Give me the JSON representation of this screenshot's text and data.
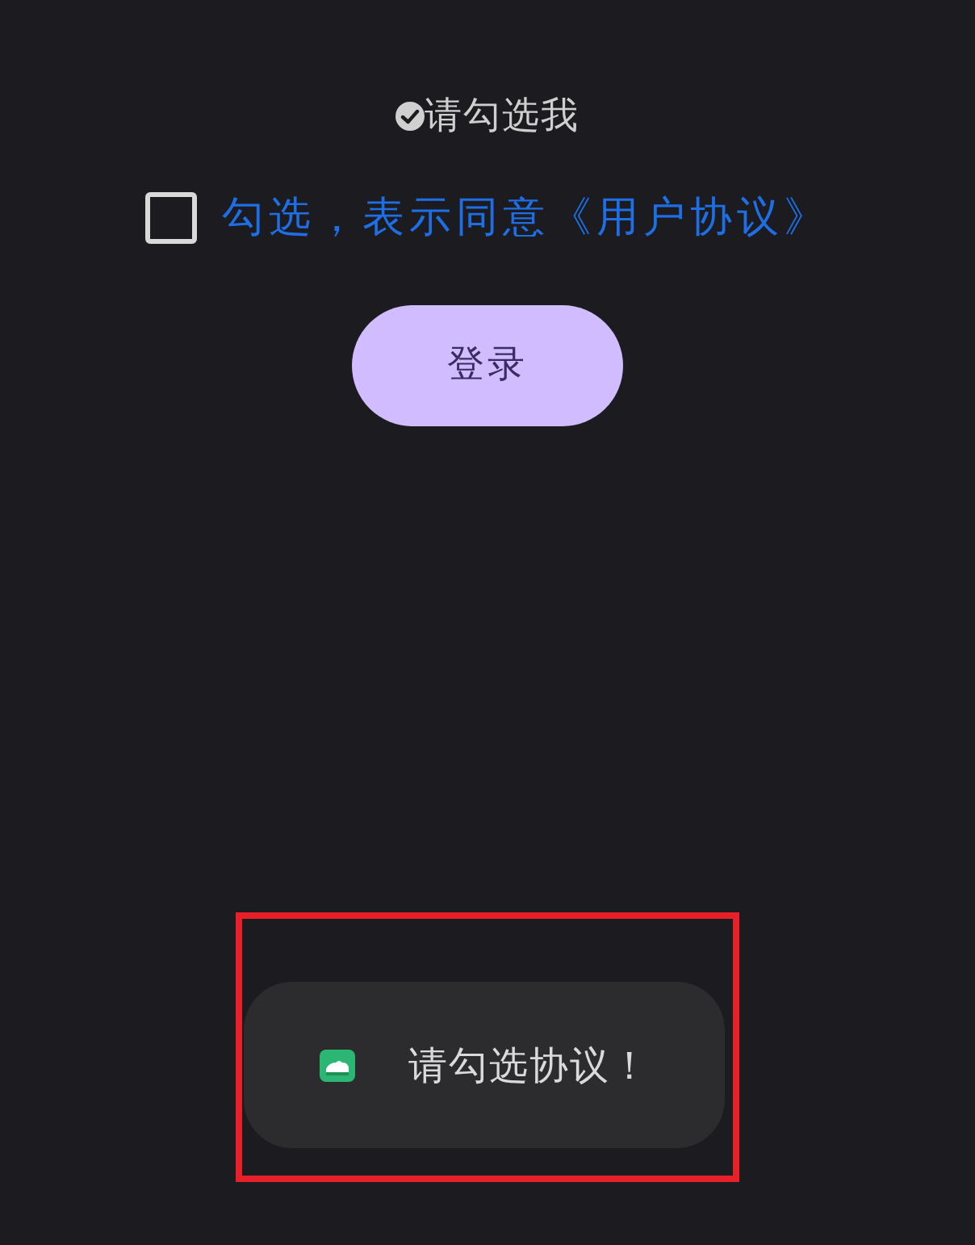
{
  "status_label": {
    "text": "请勾选我"
  },
  "agreement": {
    "checked": false,
    "label": "勾选，表示同意《用户协议》"
  },
  "login_button": {
    "label": "登录"
  },
  "toast": {
    "message": "请勾选协议！",
    "highlighted": true
  }
}
